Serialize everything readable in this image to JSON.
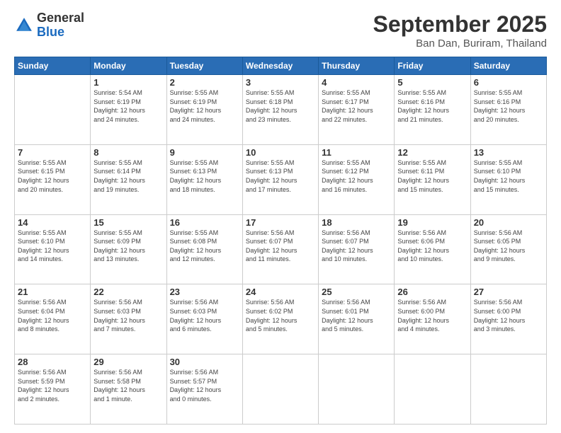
{
  "logo": {
    "general": "General",
    "blue": "Blue"
  },
  "header": {
    "month_year": "September 2025",
    "location": "Ban Dan, Buriram, Thailand"
  },
  "days_of_week": [
    "Sunday",
    "Monday",
    "Tuesday",
    "Wednesday",
    "Thursday",
    "Friday",
    "Saturday"
  ],
  "weeks": [
    [
      {
        "day": "",
        "info": ""
      },
      {
        "day": "1",
        "info": "Sunrise: 5:54 AM\nSunset: 6:19 PM\nDaylight: 12 hours\nand 24 minutes."
      },
      {
        "day": "2",
        "info": "Sunrise: 5:55 AM\nSunset: 6:19 PM\nDaylight: 12 hours\nand 24 minutes."
      },
      {
        "day": "3",
        "info": "Sunrise: 5:55 AM\nSunset: 6:18 PM\nDaylight: 12 hours\nand 23 minutes."
      },
      {
        "day": "4",
        "info": "Sunrise: 5:55 AM\nSunset: 6:17 PM\nDaylight: 12 hours\nand 22 minutes."
      },
      {
        "day": "5",
        "info": "Sunrise: 5:55 AM\nSunset: 6:16 PM\nDaylight: 12 hours\nand 21 minutes."
      },
      {
        "day": "6",
        "info": "Sunrise: 5:55 AM\nSunset: 6:16 PM\nDaylight: 12 hours\nand 20 minutes."
      }
    ],
    [
      {
        "day": "7",
        "info": "Sunrise: 5:55 AM\nSunset: 6:15 PM\nDaylight: 12 hours\nand 20 minutes."
      },
      {
        "day": "8",
        "info": "Sunrise: 5:55 AM\nSunset: 6:14 PM\nDaylight: 12 hours\nand 19 minutes."
      },
      {
        "day": "9",
        "info": "Sunrise: 5:55 AM\nSunset: 6:13 PM\nDaylight: 12 hours\nand 18 minutes."
      },
      {
        "day": "10",
        "info": "Sunrise: 5:55 AM\nSunset: 6:13 PM\nDaylight: 12 hours\nand 17 minutes."
      },
      {
        "day": "11",
        "info": "Sunrise: 5:55 AM\nSunset: 6:12 PM\nDaylight: 12 hours\nand 16 minutes."
      },
      {
        "day": "12",
        "info": "Sunrise: 5:55 AM\nSunset: 6:11 PM\nDaylight: 12 hours\nand 15 minutes."
      },
      {
        "day": "13",
        "info": "Sunrise: 5:55 AM\nSunset: 6:10 PM\nDaylight: 12 hours\nand 15 minutes."
      }
    ],
    [
      {
        "day": "14",
        "info": "Sunrise: 5:55 AM\nSunset: 6:10 PM\nDaylight: 12 hours\nand 14 minutes."
      },
      {
        "day": "15",
        "info": "Sunrise: 5:55 AM\nSunset: 6:09 PM\nDaylight: 12 hours\nand 13 minutes."
      },
      {
        "day": "16",
        "info": "Sunrise: 5:55 AM\nSunset: 6:08 PM\nDaylight: 12 hours\nand 12 minutes."
      },
      {
        "day": "17",
        "info": "Sunrise: 5:56 AM\nSunset: 6:07 PM\nDaylight: 12 hours\nand 11 minutes."
      },
      {
        "day": "18",
        "info": "Sunrise: 5:56 AM\nSunset: 6:07 PM\nDaylight: 12 hours\nand 10 minutes."
      },
      {
        "day": "19",
        "info": "Sunrise: 5:56 AM\nSunset: 6:06 PM\nDaylight: 12 hours\nand 10 minutes."
      },
      {
        "day": "20",
        "info": "Sunrise: 5:56 AM\nSunset: 6:05 PM\nDaylight: 12 hours\nand 9 minutes."
      }
    ],
    [
      {
        "day": "21",
        "info": "Sunrise: 5:56 AM\nSunset: 6:04 PM\nDaylight: 12 hours\nand 8 minutes."
      },
      {
        "day": "22",
        "info": "Sunrise: 5:56 AM\nSunset: 6:03 PM\nDaylight: 12 hours\nand 7 minutes."
      },
      {
        "day": "23",
        "info": "Sunrise: 5:56 AM\nSunset: 6:03 PM\nDaylight: 12 hours\nand 6 minutes."
      },
      {
        "day": "24",
        "info": "Sunrise: 5:56 AM\nSunset: 6:02 PM\nDaylight: 12 hours\nand 5 minutes."
      },
      {
        "day": "25",
        "info": "Sunrise: 5:56 AM\nSunset: 6:01 PM\nDaylight: 12 hours\nand 5 minutes."
      },
      {
        "day": "26",
        "info": "Sunrise: 5:56 AM\nSunset: 6:00 PM\nDaylight: 12 hours\nand 4 minutes."
      },
      {
        "day": "27",
        "info": "Sunrise: 5:56 AM\nSunset: 6:00 PM\nDaylight: 12 hours\nand 3 minutes."
      }
    ],
    [
      {
        "day": "28",
        "info": "Sunrise: 5:56 AM\nSunset: 5:59 PM\nDaylight: 12 hours\nand 2 minutes."
      },
      {
        "day": "29",
        "info": "Sunrise: 5:56 AM\nSunset: 5:58 PM\nDaylight: 12 hours\nand 1 minute."
      },
      {
        "day": "30",
        "info": "Sunrise: 5:56 AM\nSunset: 5:57 PM\nDaylight: 12 hours\nand 0 minutes."
      },
      {
        "day": "",
        "info": ""
      },
      {
        "day": "",
        "info": ""
      },
      {
        "day": "",
        "info": ""
      },
      {
        "day": "",
        "info": ""
      }
    ]
  ]
}
